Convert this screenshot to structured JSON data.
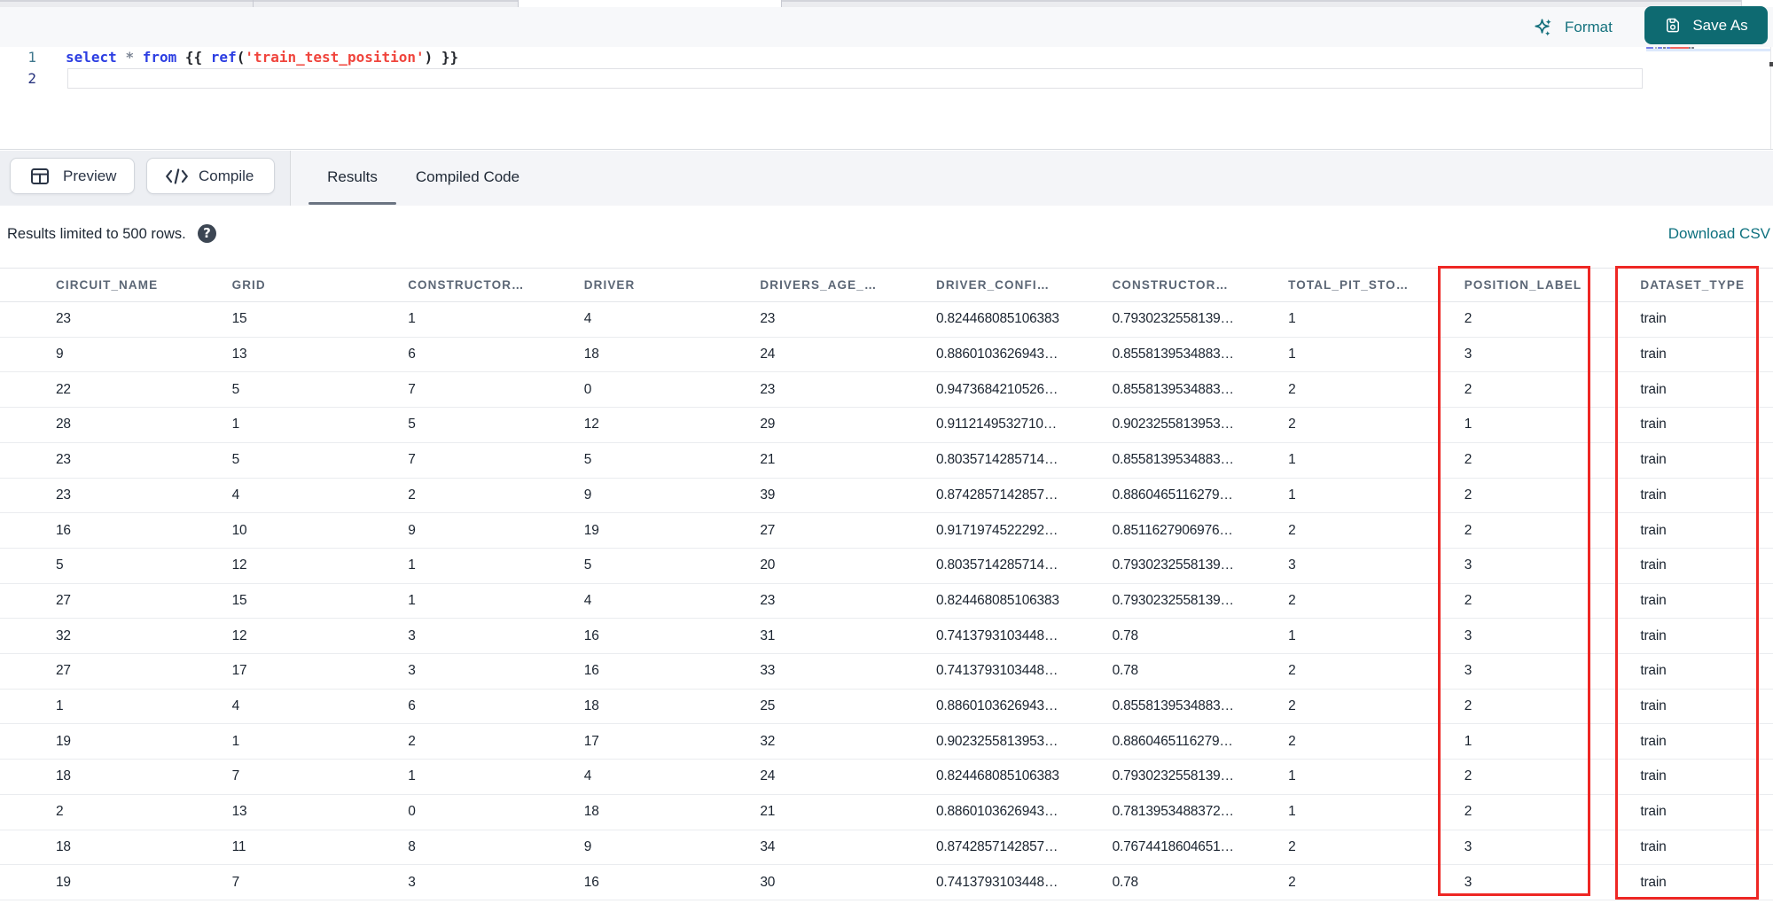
{
  "colors": {
    "accent_teal": "#0e6a71",
    "teal_text": "#15727e",
    "annotation_red": "#ee2724"
  },
  "toolbar": {
    "format_label": "Format",
    "save_as_label": "Save As"
  },
  "editor": {
    "language": "sql",
    "lines": [
      {
        "number": "1"
      },
      {
        "number": "2"
      }
    ],
    "code_tokens": [
      {
        "text": "select",
        "type": "keyword"
      },
      {
        "text": " ",
        "type": "plain"
      },
      {
        "text": "*",
        "type": "operator"
      },
      {
        "text": " ",
        "type": "plain"
      },
      {
        "text": "from",
        "type": "keyword"
      },
      {
        "text": " ",
        "type": "plain"
      },
      {
        "text": "{{",
        "type": "bracket"
      },
      {
        "text": " ",
        "type": "plain"
      },
      {
        "text": "ref",
        "type": "keyword"
      },
      {
        "text": "(",
        "type": "bracket"
      },
      {
        "text": "'train_test_position'",
        "type": "string"
      },
      {
        "text": ")",
        "type": "bracket"
      },
      {
        "text": " ",
        "type": "plain"
      },
      {
        "text": "}}",
        "type": "bracket"
      }
    ],
    "minimap_segments": [
      {
        "w": 8,
        "t": "keyword"
      },
      {
        "w": 2,
        "t": "gap"
      },
      {
        "w": 2,
        "t": "operator"
      },
      {
        "w": 1,
        "t": "gap"
      },
      {
        "w": 5,
        "t": "keyword"
      },
      {
        "w": 1,
        "t": "gap"
      },
      {
        "w": 3,
        "t": "bracket"
      },
      {
        "w": 1,
        "t": "gap"
      },
      {
        "w": 4,
        "t": "keyword"
      },
      {
        "w": 21,
        "t": "string"
      },
      {
        "w": 2,
        "t": "bracket"
      },
      {
        "w": 1,
        "t": "gap"
      },
      {
        "w": 3,
        "t": "bracket"
      }
    ]
  },
  "action_bar": {
    "preview_label": "Preview",
    "compile_label": "Compile",
    "tabs": [
      {
        "label": "Results",
        "active": true
      },
      {
        "label": "Compiled Code",
        "active": false
      }
    ]
  },
  "results_bar": {
    "limit_text": "Results limited to 500 rows.",
    "help_icon_glyph": "?",
    "download_label": "Download CSV"
  },
  "table": {
    "columns": [
      "CIRCUIT_NAME",
      "GRID",
      "CONSTRUCTOR…",
      "DRIVER",
      "DRIVERS_AGE_…",
      "DRIVER_CONFI…",
      "CONSTRUCTOR…",
      "TOTAL_PIT_STO…",
      "POSITION_LABEL",
      "DATASET_TYPE"
    ],
    "highlighted_columns": [
      "POSITION_LABEL",
      "DATASET_TYPE"
    ],
    "rows": [
      [
        "23",
        "15",
        "1",
        "4",
        "23",
        "0.824468085106383",
        "0.7930232558139…",
        "1",
        "2",
        "train"
      ],
      [
        "9",
        "13",
        "6",
        "18",
        "24",
        "0.8860103626943…",
        "0.8558139534883…",
        "1",
        "3",
        "train"
      ],
      [
        "22",
        "5",
        "7",
        "0",
        "23",
        "0.9473684210526…",
        "0.8558139534883…",
        "2",
        "2",
        "train"
      ],
      [
        "28",
        "1",
        "5",
        "12",
        "29",
        "0.9112149532710…",
        "0.9023255813953…",
        "2",
        "1",
        "train"
      ],
      [
        "23",
        "5",
        "7",
        "5",
        "21",
        "0.8035714285714…",
        "0.8558139534883…",
        "1",
        "2",
        "train"
      ],
      [
        "23",
        "4",
        "2",
        "9",
        "39",
        "0.8742857142857…",
        "0.8860465116279…",
        "1",
        "2",
        "train"
      ],
      [
        "16",
        "10",
        "9",
        "19",
        "27",
        "0.9171974522292…",
        "0.8511627906976…",
        "2",
        "2",
        "train"
      ],
      [
        "5",
        "12",
        "1",
        "5",
        "20",
        "0.8035714285714…",
        "0.7930232558139…",
        "3",
        "3",
        "train"
      ],
      [
        "27",
        "15",
        "1",
        "4",
        "23",
        "0.824468085106383",
        "0.7930232558139…",
        "2",
        "2",
        "train"
      ],
      [
        "32",
        "12",
        "3",
        "16",
        "31",
        "0.7413793103448…",
        "0.78",
        "1",
        "3",
        "train"
      ],
      [
        "27",
        "17",
        "3",
        "16",
        "33",
        "0.7413793103448…",
        "0.78",
        "2",
        "3",
        "train"
      ],
      [
        "1",
        "4",
        "6",
        "18",
        "25",
        "0.8860103626943…",
        "0.8558139534883…",
        "2",
        "2",
        "train"
      ],
      [
        "19",
        "1",
        "2",
        "17",
        "32",
        "0.9023255813953…",
        "0.8860465116279…",
        "2",
        "1",
        "train"
      ],
      [
        "18",
        "7",
        "1",
        "4",
        "24",
        "0.824468085106383",
        "0.7930232558139…",
        "1",
        "2",
        "train"
      ],
      [
        "2",
        "13",
        "0",
        "18",
        "21",
        "0.8860103626943…",
        "0.7813953488372…",
        "1",
        "2",
        "train"
      ],
      [
        "18",
        "11",
        "8",
        "9",
        "34",
        "0.8742857142857…",
        "0.7674418604651…",
        "2",
        "3",
        "train"
      ],
      [
        "19",
        "7",
        "3",
        "16",
        "30",
        "0.7413793103448…",
        "0.78",
        "2",
        "3",
        "train"
      ]
    ]
  }
}
